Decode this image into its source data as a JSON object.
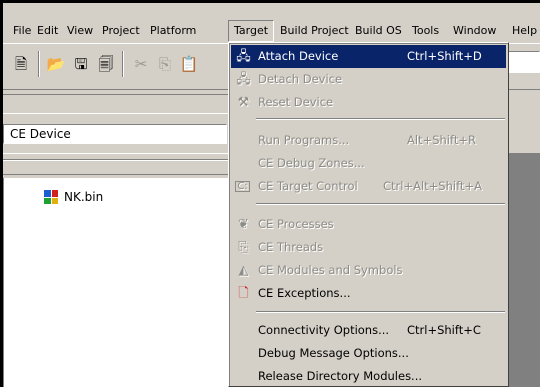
{
  "menubar": {
    "items": [
      {
        "label": "File"
      },
      {
        "label": "Edit"
      },
      {
        "label": "View"
      },
      {
        "label": "Project"
      },
      {
        "label": "Platform"
      },
      {
        "label": "Target"
      },
      {
        "label": "Build Project"
      },
      {
        "label": "Build OS"
      },
      {
        "label": "Tools"
      },
      {
        "label": "Window"
      },
      {
        "label": "Help"
      }
    ],
    "active": "Target"
  },
  "toolbar": {
    "icons": [
      "new-file-icon",
      "open-folder-icon",
      "save-icon",
      "save-all-icon",
      "cut-icon",
      "copy-icon",
      "paste-icon"
    ]
  },
  "device_combo": {
    "value": "CE Device"
  },
  "tree": {
    "items": [
      {
        "label": "NK.bin"
      }
    ]
  },
  "target_menu": {
    "items": [
      {
        "label": "Attach Device",
        "shortcut": "Ctrl+Shift+D",
        "enabled": true,
        "highlighted": true,
        "icon": "attach-device-icon"
      },
      {
        "label": "Detach Device",
        "shortcut": "",
        "enabled": false,
        "icon": "detach-device-icon"
      },
      {
        "label": "Reset Device",
        "shortcut": "",
        "enabled": false,
        "icon": "reset-device-icon"
      },
      {
        "label": "Run Programs...",
        "shortcut": "Alt+Shift+R",
        "enabled": false
      },
      {
        "label": "CE Debug Zones...",
        "shortcut": "",
        "enabled": false
      },
      {
        "label": "CE Target Control",
        "shortcut": "Ctrl+Alt+Shift+A",
        "enabled": false,
        "icon": "target-control-icon"
      },
      {
        "label": "CE Processes",
        "shortcut": "",
        "enabled": false,
        "icon": "processes-icon"
      },
      {
        "label": "CE Threads",
        "shortcut": "",
        "enabled": false,
        "icon": "threads-icon"
      },
      {
        "label": "CE Modules and Symbols",
        "shortcut": "",
        "enabled": false,
        "icon": "modules-icon"
      },
      {
        "label": "CE Exceptions...",
        "shortcut": "",
        "enabled": true,
        "icon": "exceptions-icon"
      },
      {
        "label": "Connectivity Options...",
        "shortcut": "Ctrl+Shift+C",
        "enabled": true
      },
      {
        "label": "Debug Message Options...",
        "shortcut": "",
        "enabled": true
      },
      {
        "label": "Release Directory Modules...",
        "shortcut": "",
        "enabled": true
      }
    ]
  }
}
